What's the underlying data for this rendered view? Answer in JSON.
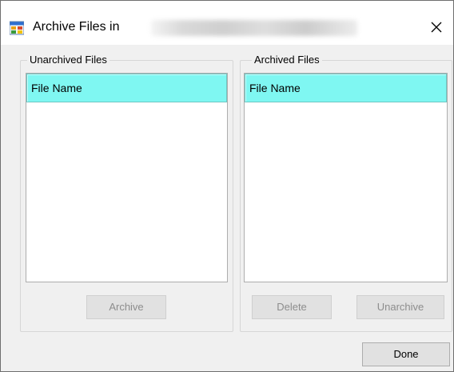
{
  "window": {
    "title": "Archive Files in",
    "close_glyph": "✕"
  },
  "unarchived": {
    "legend": "Unarchived Files",
    "column_header": "File Name",
    "archive_button": "Archive"
  },
  "archived": {
    "legend": "Archived Files",
    "column_header": "File Name",
    "delete_button": "Delete",
    "unarchive_button": "Unarchive"
  },
  "footer": {
    "done_button": "Done"
  },
  "colors": {
    "header_highlight": "#7ff7f2",
    "disabled_text": "#8d8d8d"
  }
}
